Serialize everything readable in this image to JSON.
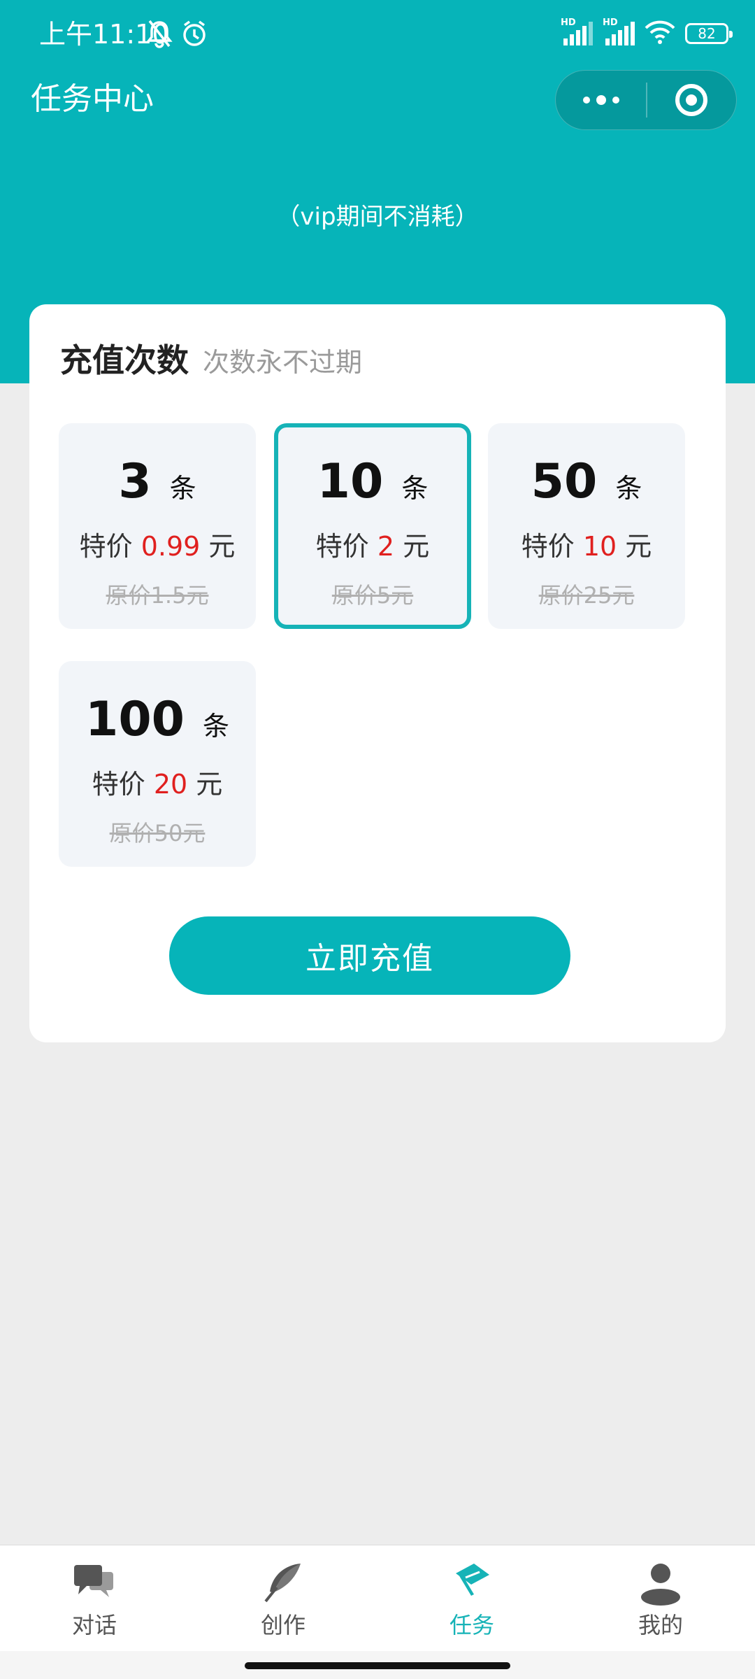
{
  "status": {
    "time": "上午11:10",
    "hd1": "HD",
    "hd2": "HD",
    "battery": "82"
  },
  "header": {
    "title": "任务中心"
  },
  "vip_note": "（vip期间不消耗）",
  "card": {
    "title": "充值次数",
    "subtitle": "次数永不过期",
    "packages": [
      {
        "count": "3",
        "unit": "条",
        "price_prefix": "特价",
        "price": "0.99",
        "price_unit": "元",
        "original": "原价1.5元",
        "selected": false
      },
      {
        "count": "10",
        "unit": "条",
        "price_prefix": "特价",
        "price": "2",
        "price_unit": "元",
        "original": "原价5元",
        "selected": true
      },
      {
        "count": "50",
        "unit": "条",
        "price_prefix": "特价",
        "price": "10",
        "price_unit": "元",
        "original": "原价25元",
        "selected": false
      },
      {
        "count": "100",
        "unit": "条",
        "price_prefix": "特价",
        "price": "20",
        "price_unit": "元",
        "original": "原价50元",
        "selected": false
      }
    ],
    "button_label": "立即充值"
  },
  "tabbar": {
    "items": [
      {
        "label": "对话",
        "icon": "chat-icon",
        "active": false
      },
      {
        "label": "创作",
        "icon": "feather-icon",
        "active": false
      },
      {
        "label": "任务",
        "icon": "flag-icon",
        "active": true
      },
      {
        "label": "我的",
        "icon": "person-icon",
        "active": false
      }
    ]
  },
  "colors": {
    "brand": "#06b4b9",
    "price_red": "#e0201f",
    "selected_border": "#16b3b7"
  }
}
